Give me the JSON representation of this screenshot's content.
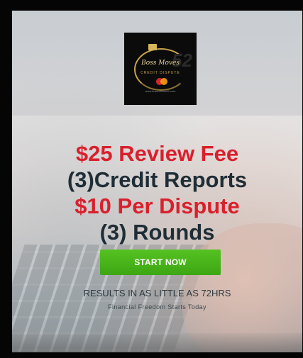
{
  "logo": {
    "brand_script": "Boss Moves",
    "brand_sub": "CREDIT DISPUTE",
    "brand_number": "52",
    "brand_url": "www.bossmoves52.com"
  },
  "headline": {
    "line1": "$25 Review Fee",
    "line2": "(3)Credit Reports",
    "line3": "$10 Per Dispute",
    "line4": "(3) Rounds"
  },
  "cta": {
    "label": "START NOW"
  },
  "results": {
    "text": "RESULTS IN AS LITTLE AS 72HRS"
  },
  "tagline": {
    "text": "Financial Freedom Starts Today"
  },
  "colors": {
    "headline_red": "#d9202c",
    "headline_dark": "#1f2d36",
    "cta_green": "#4cb81c",
    "logo_gold": "#c6a24a"
  }
}
